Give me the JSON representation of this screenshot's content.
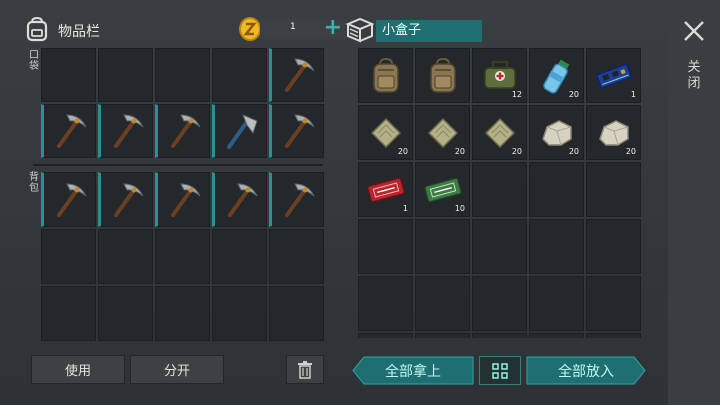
{
  "inventory": {
    "title": "物品栏",
    "coins": "1",
    "add_label": "+",
    "pocket_label": "口袋",
    "backpack_label": "背包",
    "pocket_slots": [
      {
        "item": "",
        "qty": ""
      },
      {
        "item": "",
        "qty": ""
      },
      {
        "item": "",
        "qty": ""
      },
      {
        "item": "",
        "qty": ""
      },
      {
        "item": "pickaxe-icon",
        "qty": "",
        "equip": true
      },
      {
        "item": "pickaxe-icon",
        "qty": "",
        "equip": true
      },
      {
        "item": "pickaxe-icon",
        "qty": "",
        "equip": true
      },
      {
        "item": "pickaxe-icon",
        "qty": "",
        "equip": true
      },
      {
        "item": "hatchet-icon",
        "qty": "",
        "equip": true
      },
      {
        "item": "pickaxe-icon",
        "qty": "",
        "equip": true
      }
    ],
    "backpack_slots": [
      {
        "item": "pickaxe-icon",
        "qty": "",
        "equip": true
      },
      {
        "item": "pickaxe-icon",
        "qty": "",
        "equip": true
      },
      {
        "item": "pickaxe-icon",
        "qty": "",
        "equip": true
      },
      {
        "item": "pickaxe-icon",
        "qty": "",
        "equip": true
      },
      {
        "item": "pickaxe-icon",
        "qty": "",
        "equip": true
      },
      {
        "item": "",
        "qty": ""
      },
      {
        "item": "",
        "qty": ""
      },
      {
        "item": "",
        "qty": ""
      },
      {
        "item": "",
        "qty": ""
      },
      {
        "item": "",
        "qty": ""
      },
      {
        "item": "",
        "qty": ""
      },
      {
        "item": "",
        "qty": ""
      },
      {
        "item": "",
        "qty": ""
      },
      {
        "item": "",
        "qty": ""
      },
      {
        "item": "",
        "qty": ""
      }
    ]
  },
  "actions": {
    "use": "使用",
    "split": "分开",
    "trash_icon": "trash-icon"
  },
  "box": {
    "title": "小盒子",
    "slots": [
      {
        "item": "backpack-icon",
        "qty": ""
      },
      {
        "item": "backpack-icon",
        "qty": ""
      },
      {
        "item": "first-aid-kit-icon",
        "qty": "12"
      },
      {
        "item": "water-bottle-icon",
        "qty": "20"
      },
      {
        "item": "circuit-board-icon",
        "qty": "1"
      },
      {
        "item": "cloth-icon",
        "qty": "20"
      },
      {
        "item": "cloth-icon",
        "qty": "20"
      },
      {
        "item": "cloth-icon",
        "qty": "20"
      },
      {
        "item": "stone-icon",
        "qty": "20"
      },
      {
        "item": "stone-icon",
        "qty": "20"
      },
      {
        "item": "red-coupon-icon",
        "qty": "1"
      },
      {
        "item": "green-coupon-icon",
        "qty": "10"
      },
      {
        "item": "",
        "qty": ""
      },
      {
        "item": "",
        "qty": ""
      },
      {
        "item": "",
        "qty": ""
      },
      {
        "item": "",
        "qty": ""
      },
      {
        "item": "",
        "qty": ""
      },
      {
        "item": "",
        "qty": ""
      },
      {
        "item": "",
        "qty": ""
      },
      {
        "item": "",
        "qty": ""
      },
      {
        "item": "",
        "qty": ""
      },
      {
        "item": "",
        "qty": ""
      },
      {
        "item": "",
        "qty": ""
      },
      {
        "item": "",
        "qty": ""
      },
      {
        "item": "",
        "qty": ""
      },
      {
        "item": "",
        "qty": ""
      },
      {
        "item": "",
        "qty": ""
      },
      {
        "item": "",
        "qty": ""
      },
      {
        "item": "",
        "qty": ""
      },
      {
        "item": "",
        "qty": ""
      }
    ],
    "take_all": "全部拿上",
    "put_all": "全部放入",
    "sort_icon": "grid-sort-icon"
  },
  "close": {
    "label": "关闭"
  },
  "colors": {
    "accent": "#37b4b0",
    "box_title_bg": "#1e6f72",
    "equip_marker": "#2b8f95"
  }
}
